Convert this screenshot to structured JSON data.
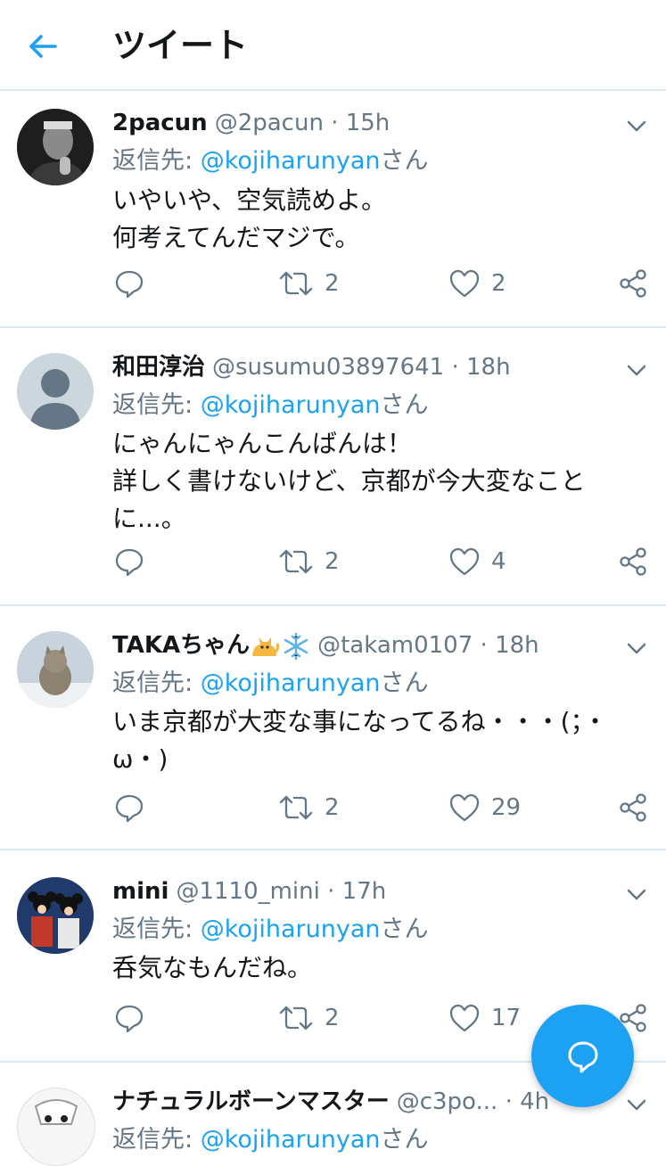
{
  "header": {
    "title": "ツイート"
  },
  "tweets": [
    {
      "name": "2pacun",
      "handle": "@2pacun",
      "sep": "·",
      "time": "15h",
      "reply_prefix": "返信先: ",
      "reply_to": "@kojiharunyan",
      "reply_suffix": "さん",
      "lines": [
        "いやいや、空気読めよ。",
        "何考えてんだマジで。"
      ],
      "retweets": "2",
      "likes": "2"
    },
    {
      "name": "和田淳治",
      "handle": "@susumu03897641",
      "sep": "·",
      "time": "18h",
      "reply_prefix": "返信先: ",
      "reply_to": "@kojiharunyan",
      "reply_suffix": "さん",
      "lines": [
        "にゃんにゃんこんばんは！",
        "詳しく書けないけど、京都が今大変なこと",
        "に...。"
      ],
      "retweets": "2",
      "likes": "4"
    },
    {
      "name": "TAKAちゃん",
      "handle": "@takam0107",
      "sep": "·",
      "time": "18h",
      "reply_prefix": "返信先: ",
      "reply_to": "@kojiharunyan",
      "reply_suffix": "さん",
      "lines": [
        "いま京都が大変な事になってるね・・・(；・",
        "ω・)"
      ],
      "retweets": "2",
      "likes": "29"
    },
    {
      "name": "mini",
      "handle": "@1110_mini",
      "sep": "·",
      "time": "17h",
      "reply_prefix": "返信先: ",
      "reply_to": "@kojiharunyan",
      "reply_suffix": "さん",
      "lines": [
        "呑気なもんだね。"
      ],
      "retweets": "2",
      "likes": "17"
    },
    {
      "name": "ナチュラルボーンマスター",
      "handle": "@c3po...",
      "sep": "·",
      "time": "4h",
      "reply_prefix": "返信先: ",
      "reply_to": "@kojiharunyan",
      "reply_suffix": "さん",
      "lines": [],
      "retweets": "",
      "likes": ""
    }
  ],
  "icons": {
    "back": "arrow-left-icon",
    "expand": "chevron-down-icon",
    "reply": "speech-bubble-icon",
    "retweet": "retweet-icon",
    "like": "heart-icon",
    "share": "share-icon",
    "compose": "compose-reply-icon"
  },
  "colors": {
    "accent": "#1da1f2",
    "muted": "#657786",
    "text": "#14171a",
    "divider": "#e1e8ed"
  }
}
